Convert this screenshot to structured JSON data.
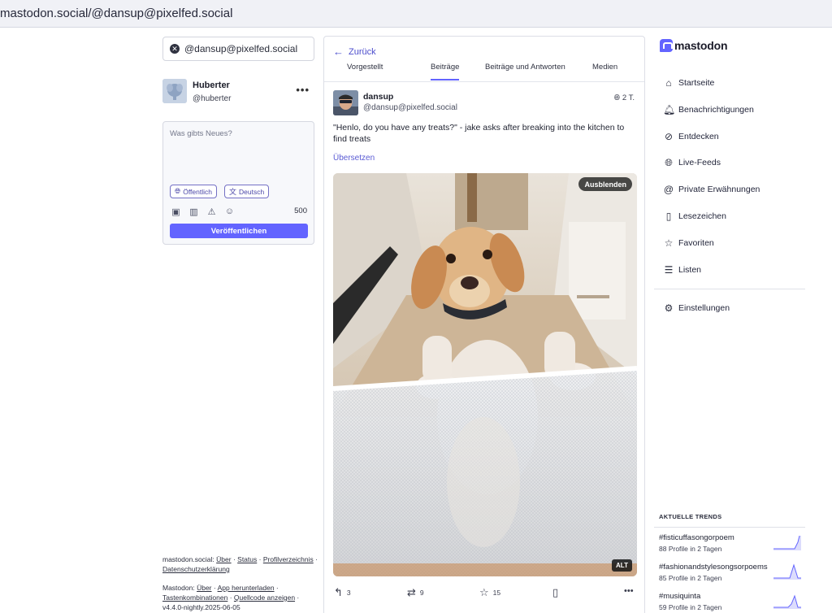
{
  "browser": {
    "url": "mastodon.social/@dansup@pixelfed.social"
  },
  "search": {
    "value": "@dansup@pixelfed.social"
  },
  "account": {
    "display_name": "Huberter",
    "handle": "@huberter"
  },
  "compose": {
    "placeholder": "Was gibts Neues?",
    "visibility_label": "Öffentlich",
    "language_label": "Deutsch",
    "char_count": "500",
    "publish_label": "Veröffentlichen"
  },
  "profile": {
    "back_label": "Zurück",
    "tabs": [
      "Vorgestellt",
      "Beiträge",
      "Beiträge und Antworten",
      "Medien"
    ],
    "active_tab": "Beiträge"
  },
  "post": {
    "author_name": "dansup",
    "author_handle": "@dansup@pixelfed.social",
    "time": "2 T.",
    "text": "\"Henlo, do you have any treats?\" - jake asks after breaking into the kitchen to find treats",
    "translate_label": "Übersetzen",
    "hide_label": "Ausblenden",
    "alt_label": "ALT",
    "replies": "3",
    "boosts": "9",
    "favourites": "15"
  },
  "nav": {
    "items": [
      {
        "label": "Startseite",
        "icon": "home-icon"
      },
      {
        "label": "Benachrichtigungen",
        "icon": "bell-icon"
      },
      {
        "label": "Entdecken",
        "icon": "compass-icon"
      },
      {
        "label": "Live-Feeds",
        "icon": "globe-icon"
      },
      {
        "label": "Private Erwähnungen",
        "icon": "at-icon"
      },
      {
        "label": "Lesezeichen",
        "icon": "bookmark-icon"
      },
      {
        "label": "Favoriten",
        "icon": "star-icon"
      },
      {
        "label": "Listen",
        "icon": "list-icon"
      }
    ],
    "settings_label": "Einstellungen"
  },
  "brand": {
    "name": "mastodon",
    "accent": "#6364ff"
  },
  "trends": {
    "heading": "AKTUELLE TRENDS",
    "items": [
      {
        "tag": "#fisticuffasongorpoem",
        "sub": "88 Profile in 2 Tagen"
      },
      {
        "tag": "#fashionandstylesongsorpoems",
        "sub": "85 Profile in 2 Tagen"
      },
      {
        "tag": "#musiquinta",
        "sub": "59 Profile in 2 Tagen"
      }
    ]
  },
  "footer": {
    "server_name": "mastodon.social",
    "about": "Über",
    "status": "Status",
    "profiles": "Profilverzeichnis",
    "privacy": "Datenschutzerklärung",
    "app_name": "Mastodon",
    "app_about": "Über",
    "download": "App herunterladen",
    "shortcuts": "Tastenkombinationen",
    "source": "Quellcode anzeigen",
    "version": "v4.4.0-nightly.2025-06-05"
  }
}
